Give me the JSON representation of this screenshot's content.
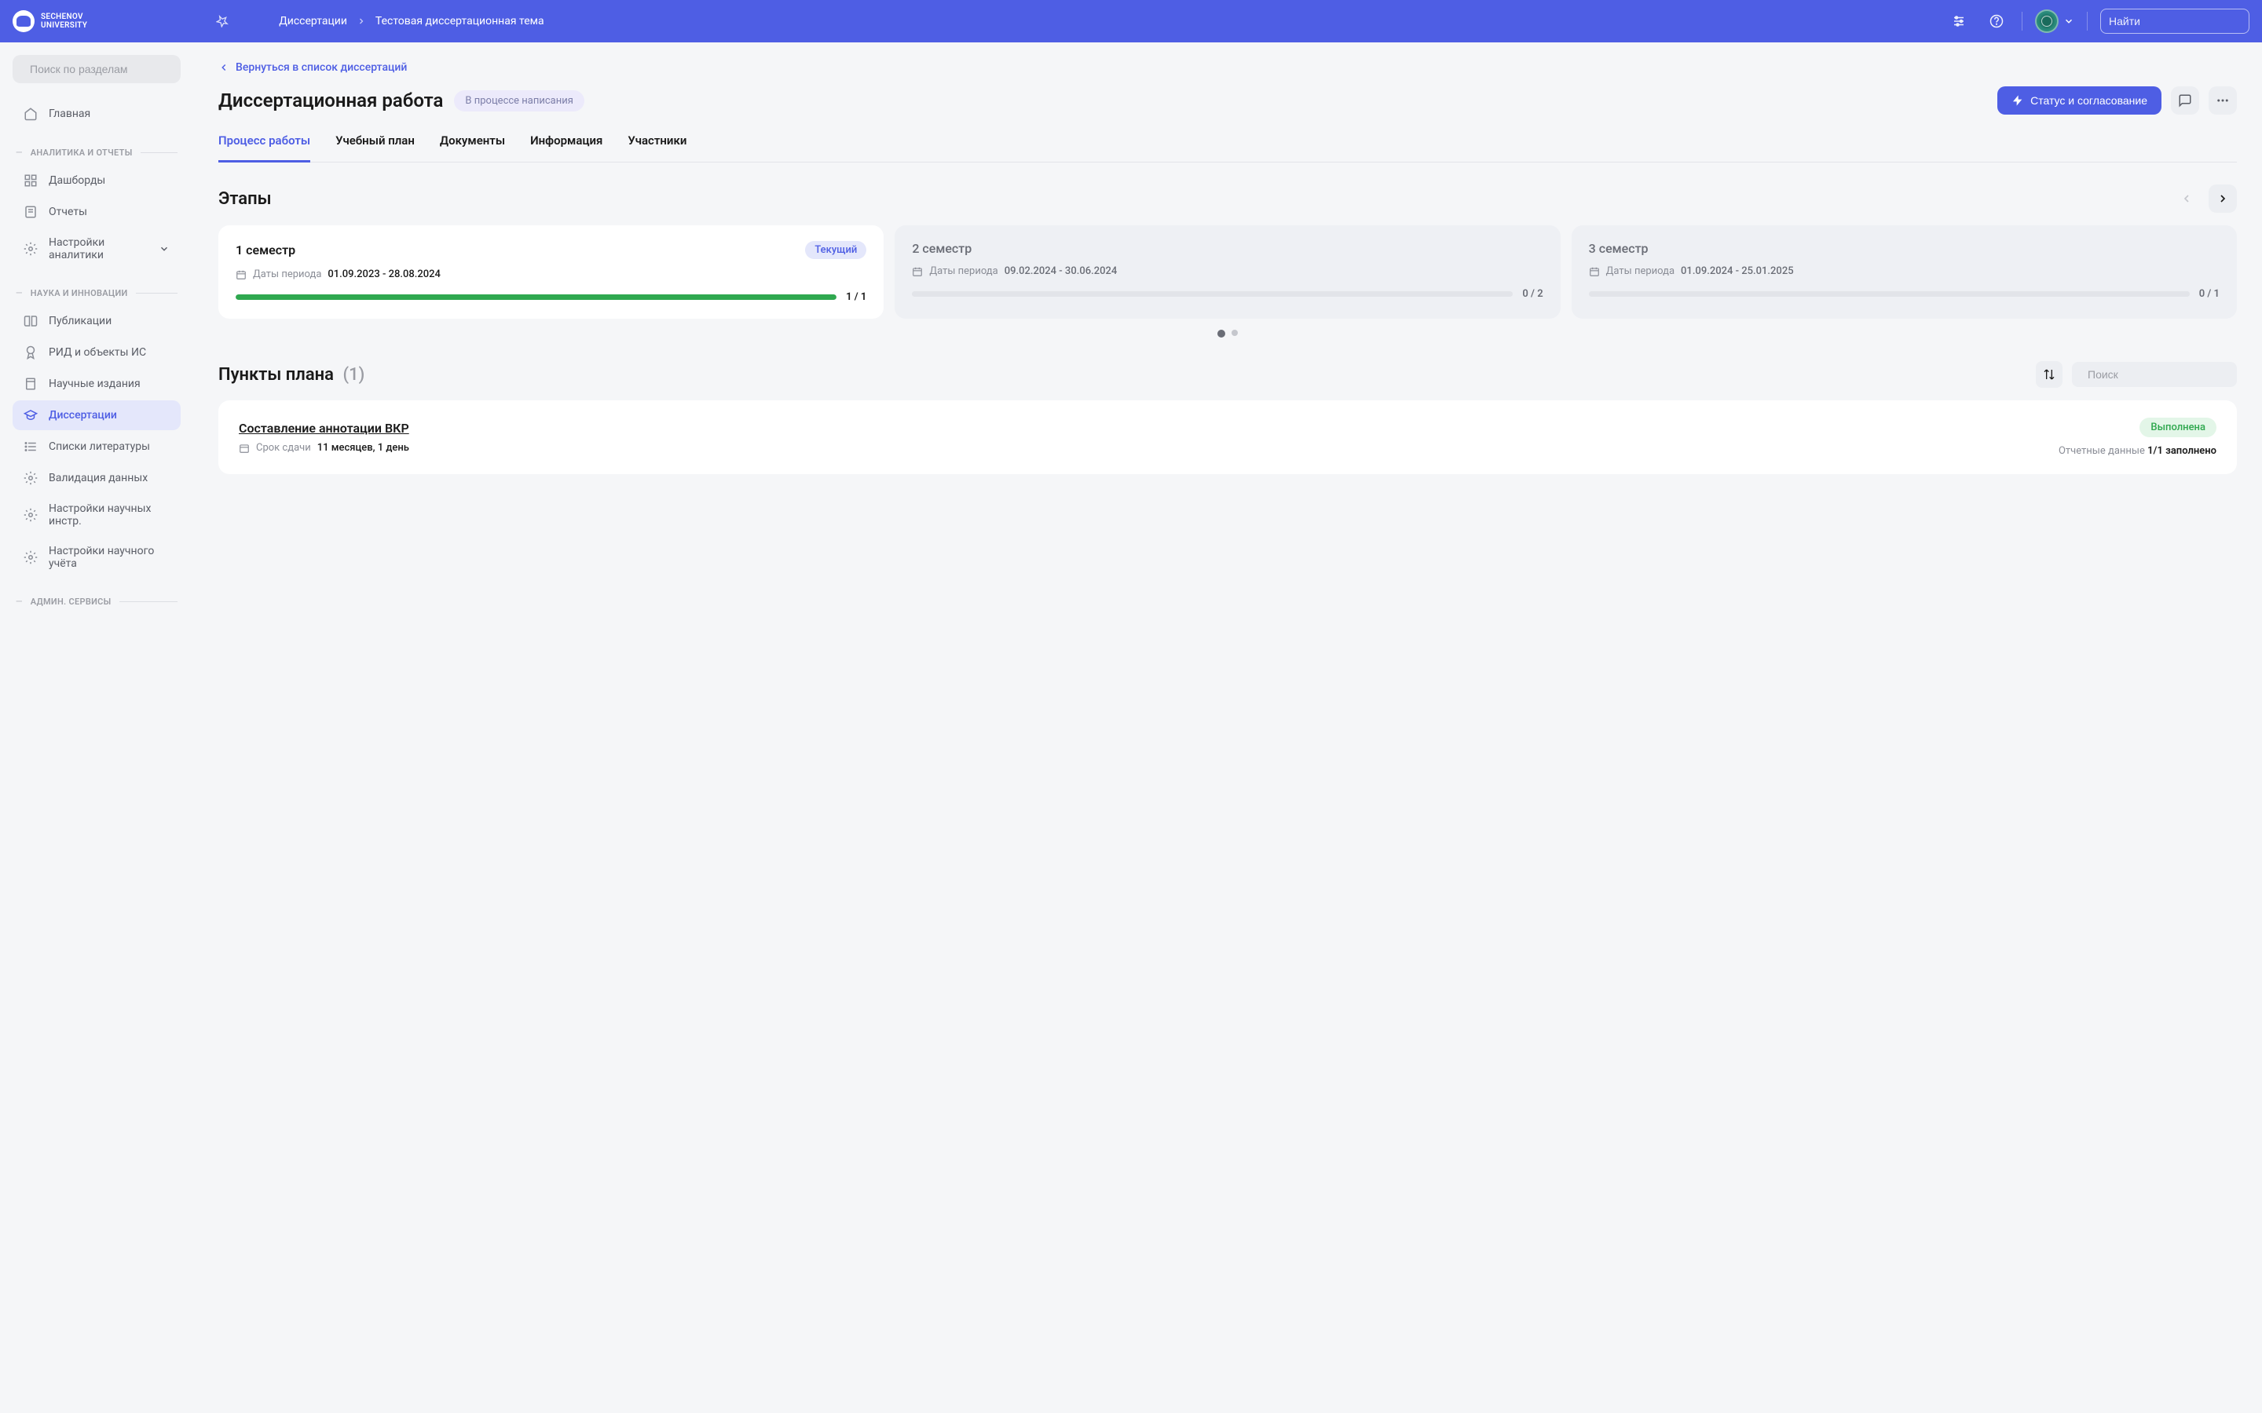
{
  "logo": {
    "line1": "Sechenov",
    "line2": "University"
  },
  "topbar": {
    "breadcrumb": [
      "Диссертации",
      "Тестовая диссертационная тема"
    ],
    "search_placeholder": "Найти"
  },
  "sidebar": {
    "search_placeholder": "Поиск по разделам",
    "home": "Главная",
    "sections": [
      {
        "label": "АНАЛИТИКА И ОТЧЕТЫ",
        "items": [
          {
            "label": "Дашборды",
            "icon": "dashboard"
          },
          {
            "label": "Отчеты",
            "icon": "report"
          },
          {
            "label": "Настройки аналитики",
            "icon": "gear",
            "chevron": true
          }
        ]
      },
      {
        "label": "НАУКА И ИННОВАЦИИ",
        "items": [
          {
            "label": "Публикации",
            "icon": "book"
          },
          {
            "label": "РИД и объекты ИС",
            "icon": "badge"
          },
          {
            "label": "Научные издания",
            "icon": "journal"
          },
          {
            "label": "Диссертации",
            "icon": "gradcap",
            "active": true
          },
          {
            "label": "Списки литературы",
            "icon": "list"
          },
          {
            "label": "Валидация данных",
            "icon": "gear"
          },
          {
            "label": "Настройки научных инстр.",
            "icon": "gear"
          },
          {
            "label": "Настройки научного учёта",
            "icon": "gear"
          }
        ]
      },
      {
        "label": "АДМИН. СЕРВИСЫ",
        "items": []
      }
    ]
  },
  "back_link": "Вернуться в список диссертаций",
  "page_title": "Диссертационная работа",
  "status_badge": "В процессе написания",
  "primary_action": "Статус и согласование",
  "tabs": [
    "Процесс работы",
    "Учебный план",
    "Документы",
    "Информация",
    "Участники"
  ],
  "active_tab": 0,
  "stages": {
    "title": "Этапы",
    "dates_label": "Даты периода",
    "cards": [
      {
        "title": "1 семестр",
        "current": true,
        "dates": "01.09.2023 - 28.08.2024",
        "progress": 100,
        "count": "1 / 1"
      },
      {
        "title": "2 семестр",
        "current": false,
        "dates": "09.02.2024 - 30.06.2024",
        "progress": 0,
        "count": "0 / 2"
      },
      {
        "title": "3 семестр",
        "current": false,
        "dates": "01.09.2024 - 25.01.2025",
        "progress": 0,
        "count": "0 / 1"
      }
    ],
    "current_badge": "Текущий"
  },
  "plan": {
    "title": "Пункты плана",
    "count": "(1)",
    "search_placeholder": "Поиск",
    "items": [
      {
        "title": "Составление аннотации ВКР",
        "due_label": "Срок сдачи",
        "due_value": "11 месяцев, 1 день",
        "status": "Выполнена",
        "report_label": "Отчетные данные",
        "report_value": "1/1 заполнено"
      }
    ]
  }
}
